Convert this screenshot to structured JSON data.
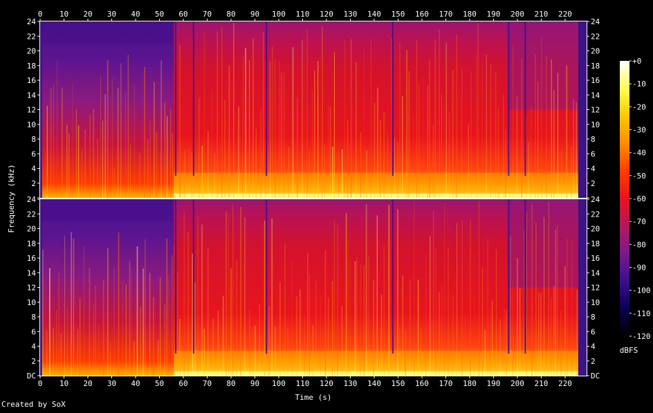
{
  "chart_data": {
    "type": "heatmap",
    "title": "",
    "xlabel": "Time (s)",
    "ylabel": "Frequency (kHz)",
    "x_ticks": [
      0,
      10,
      20,
      30,
      40,
      50,
      60,
      70,
      80,
      90,
      100,
      110,
      120,
      130,
      140,
      150,
      160,
      170,
      180,
      190,
      200,
      210,
      220
    ],
    "xlim": [
      0,
      229
    ],
    "ylim": [
      0,
      24
    ],
    "y_ticks": [
      {
        "value": 0,
        "label": "DC"
      },
      {
        "value": 2,
        "label": "2"
      },
      {
        "value": 4,
        "label": "4"
      },
      {
        "value": 6,
        "label": "6"
      },
      {
        "value": 8,
        "label": "8"
      },
      {
        "value": 10,
        "label": "10"
      },
      {
        "value": 12,
        "label": "12"
      },
      {
        "value": 14,
        "label": "14"
      },
      {
        "value": 16,
        "label": "16"
      },
      {
        "value": 18,
        "label": "18"
      },
      {
        "value": 20,
        "label": "20"
      },
      {
        "value": 22,
        "label": "22"
      },
      {
        "value": 24,
        "label": "24"
      }
    ],
    "channels": 2,
    "colorbar": {
      "label": "dBFS",
      "range": [
        -120,
        0
      ],
      "ticks": [
        {
          "value": 0,
          "label": "+0"
        },
        {
          "value": -10,
          "label": "-10"
        },
        {
          "value": -20,
          "label": "-20"
        },
        {
          "value": -30,
          "label": "-30"
        },
        {
          "value": -40,
          "label": "-40"
        },
        {
          "value": -50,
          "label": "-50"
        },
        {
          "value": -60,
          "label": "-60"
        },
        {
          "value": -70,
          "label": "-70"
        },
        {
          "value": -80,
          "label": "-80"
        },
        {
          "value": -90,
          "label": "-90"
        },
        {
          "value": -100,
          "label": "-100"
        },
        {
          "value": -110,
          "label": "-110"
        },
        {
          "value": -120,
          "label": "-120"
        }
      ],
      "colors": [
        "#000000",
        "#0b0050",
        "#3a0f8f",
        "#7a1a8c",
        "#b3175e",
        "#e8141e",
        "#ff3c00",
        "#ff8c00",
        "#ffc800",
        "#ffff50",
        "#ffffff"
      ]
    },
    "grid": false
  },
  "footer": {
    "credit": "Created by SoX"
  }
}
